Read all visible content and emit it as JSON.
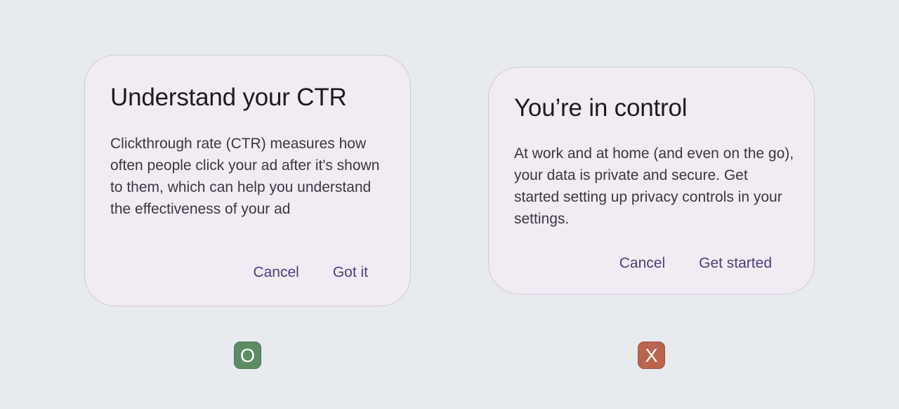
{
  "examples": [
    {
      "title": "Understand your CTR",
      "body": "Clickthrough rate (CTR) measures how often people click your ad after it's shown to them, which can help you understand the effectiveness of your ad",
      "actions": {
        "cancel_label": "Cancel",
        "confirm_label": "Got it"
      },
      "marker": {
        "label": "O",
        "color": "#5c8c64"
      }
    },
    {
      "title": "You’re in control",
      "body": "At work and at home (and even on the go), your data is private and secure. Get started setting up privacy controls in your settings.",
      "actions": {
        "cancel_label": "Cancel",
        "confirm_label": "Get started"
      },
      "marker": {
        "label": "X",
        "color": "#b9644f"
      }
    }
  ],
  "colors": {
    "background": "#e8ebee",
    "dialog_surface": "#f1ecf4",
    "button_text": "#4c3f78"
  }
}
